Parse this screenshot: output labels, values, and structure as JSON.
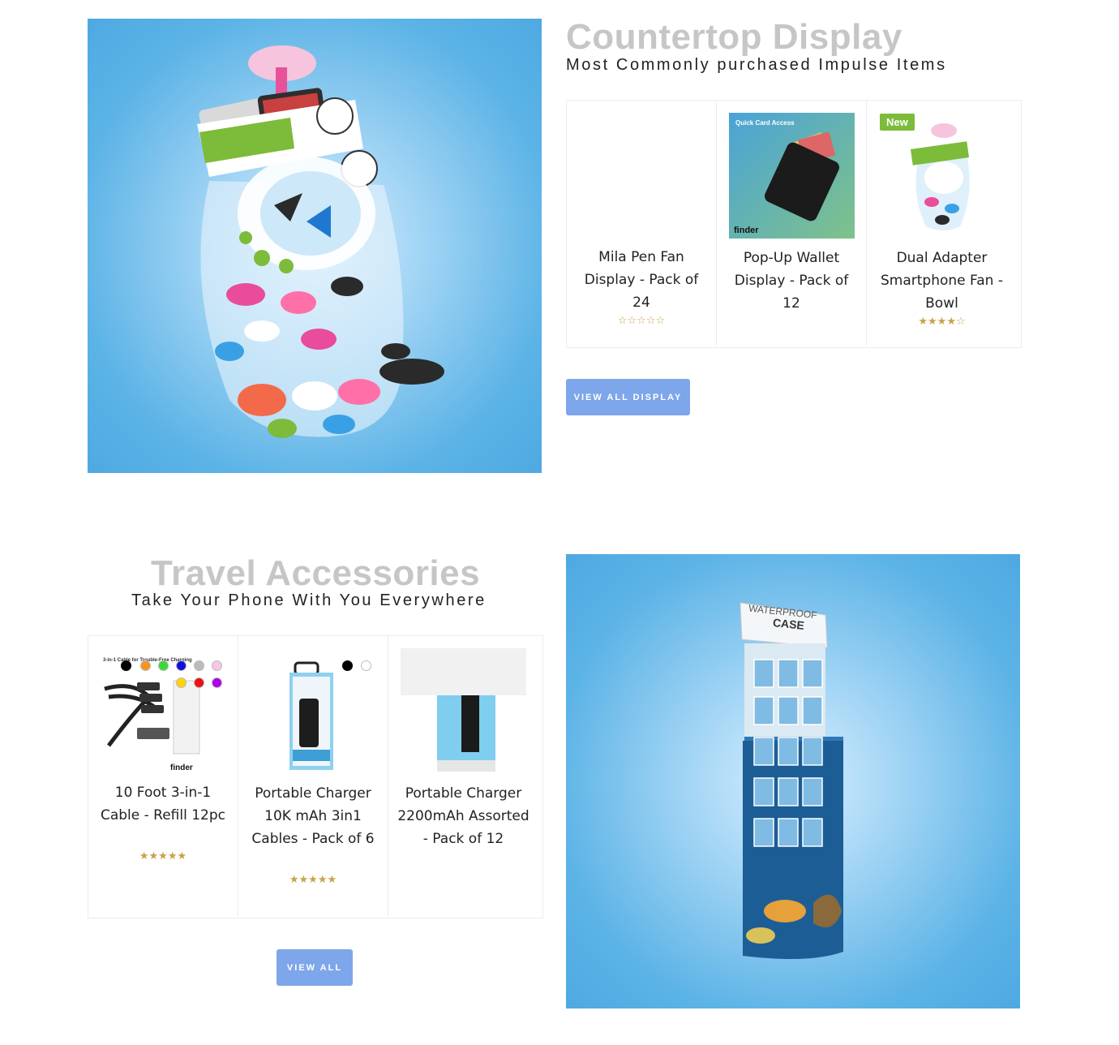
{
  "countertop": {
    "title": "Countertop Display",
    "subtitle": "Most Commonly purchased Impulse Items",
    "hero_image": "mila-smartphone-fan-bowl-image",
    "products": [
      {
        "name": "Mila Pen Fan Display - Pack of 24",
        "rating": 0,
        "stars": "☆☆☆☆☆",
        "badge": ""
      },
      {
        "name": "Pop-Up Wallet Display - Pack of 12",
        "rating": null,
        "stars": "",
        "badge": "",
        "thumb_text": "Quick Card Access",
        "brand": "finder"
      },
      {
        "name": "Dual Adapter Smartphone Fan - Bowl",
        "rating": 4,
        "stars": "★★★★☆",
        "badge": "New"
      }
    ],
    "button_label": "VIEW ALL DISPLAY"
  },
  "travel": {
    "title": "Travel Accessories",
    "subtitle": "Take Your Phone With You Everywhere",
    "hero_image": "waterproof-case-floor-display-image",
    "hero_text": {
      "line1": "WATERPROOF",
      "line2": "CASE"
    },
    "products": [
      {
        "name": "10 Foot 3-in-1 Cable - Refill 12pc",
        "rating": 5,
        "stars": "★★★★★",
        "thumb_text": "3-in-1 Cable for Trouble-Free Charging",
        "brand": "finder",
        "swatches": [
          "#000000",
          "#f7941d",
          "#39d939",
          "#1010e0",
          "#bbbbbb",
          "#f6c6e4",
          "#ffd400",
          "#ee1111",
          "#b000e8"
        ]
      },
      {
        "name": "Portable Charger 10K mAh 3in1 Cables - Pack of 6",
        "rating": 5,
        "stars": "★★★★★",
        "swatches": [
          "#000000",
          "#ffffff"
        ]
      },
      {
        "name": "Portable Charger 2200mAh Assorted - Pack of 12",
        "rating": null,
        "stars": ""
      }
    ],
    "button_label": "VIEW ALL"
  },
  "colors": {
    "accent_button": "#7ea6ea",
    "hero_blue": "#5bb3e6",
    "star_gold": "#c8a24a",
    "new_badge": "#7dbb3a",
    "title_gray": "#c6c6c6"
  }
}
